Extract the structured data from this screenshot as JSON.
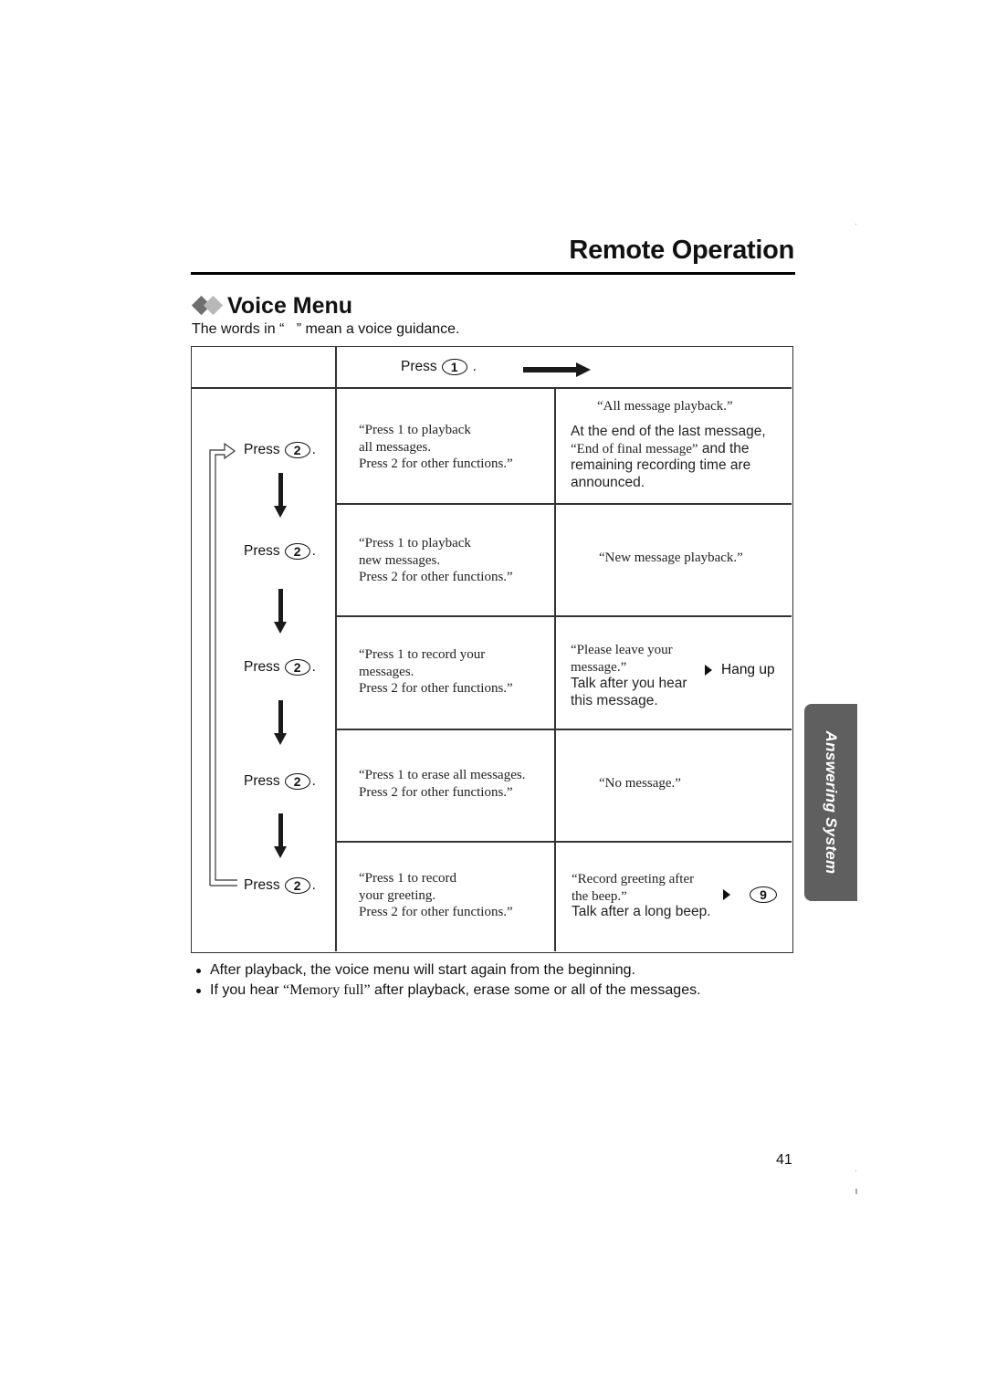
{
  "page": {
    "heading": "Remote Operation",
    "section_title": "Voice Menu",
    "intro": "The words in “   ” mean a voice guidance.",
    "page_number": "41",
    "side_tab": "Answering System"
  },
  "icons": {
    "section_marker": "double-diamond-icon",
    "flow_arrow_right": "arrow-right-icon",
    "flow_arrow_down": "arrow-down-icon",
    "loop_arrow": "loop-back-arrow-icon",
    "result_pointer": "small-arrow-right-icon"
  },
  "table": {
    "header": {
      "press_label": "Press",
      "key": "1",
      "suffix": "."
    },
    "rows": [
      {
        "press_label": "Press",
        "key": "2",
        "suffix": ".",
        "prompt": "“Press 1 to playback\nall messages.\nPress 2 for other functions.”",
        "result_voice": "“All message playback.”",
        "result_note_1": "At the end of the last message,",
        "result_note_voice": "“End of final message”",
        "result_note_2": " and the",
        "result_note_3": "remaining recording time are",
        "result_note_4": "announced."
      },
      {
        "press_label": "Press",
        "key": "2",
        "suffix": ".",
        "prompt": "“Press 1 to playback\nnew messages.\nPress 2 for other functions.”",
        "result_voice": "“New message playback.”"
      },
      {
        "press_label": "Press",
        "key": "2",
        "suffix": ".",
        "prompt": "“Press 1 to record your\nmessages.\nPress 2 for other functions.”",
        "result_voice": "“Please leave your\nmessage.”",
        "result_note": "Talk after you hear\nthis message.",
        "action": "Hang up"
      },
      {
        "press_label": "Press",
        "key": "2",
        "suffix": ".",
        "prompt": "“Press 1 to erase all messages.\nPress 2 for other functions.”",
        "result_voice": "“No message.”"
      },
      {
        "press_label": "Press",
        "key": "2",
        "suffix": ".",
        "prompt": "“Press 1 to record\nyour greeting.\nPress 2 for other functions.”",
        "result_voice": "“Record greeting after\nthe beep.”",
        "result_note": "Talk after a long beep.",
        "action_key": "9"
      }
    ]
  },
  "notes": [
    {
      "text": "After playback, the voice menu will start again from the beginning."
    },
    {
      "pre": "If you hear ",
      "voice": "“Memory full”",
      "post": " after playback, erase some or all of the messages."
    }
  ]
}
